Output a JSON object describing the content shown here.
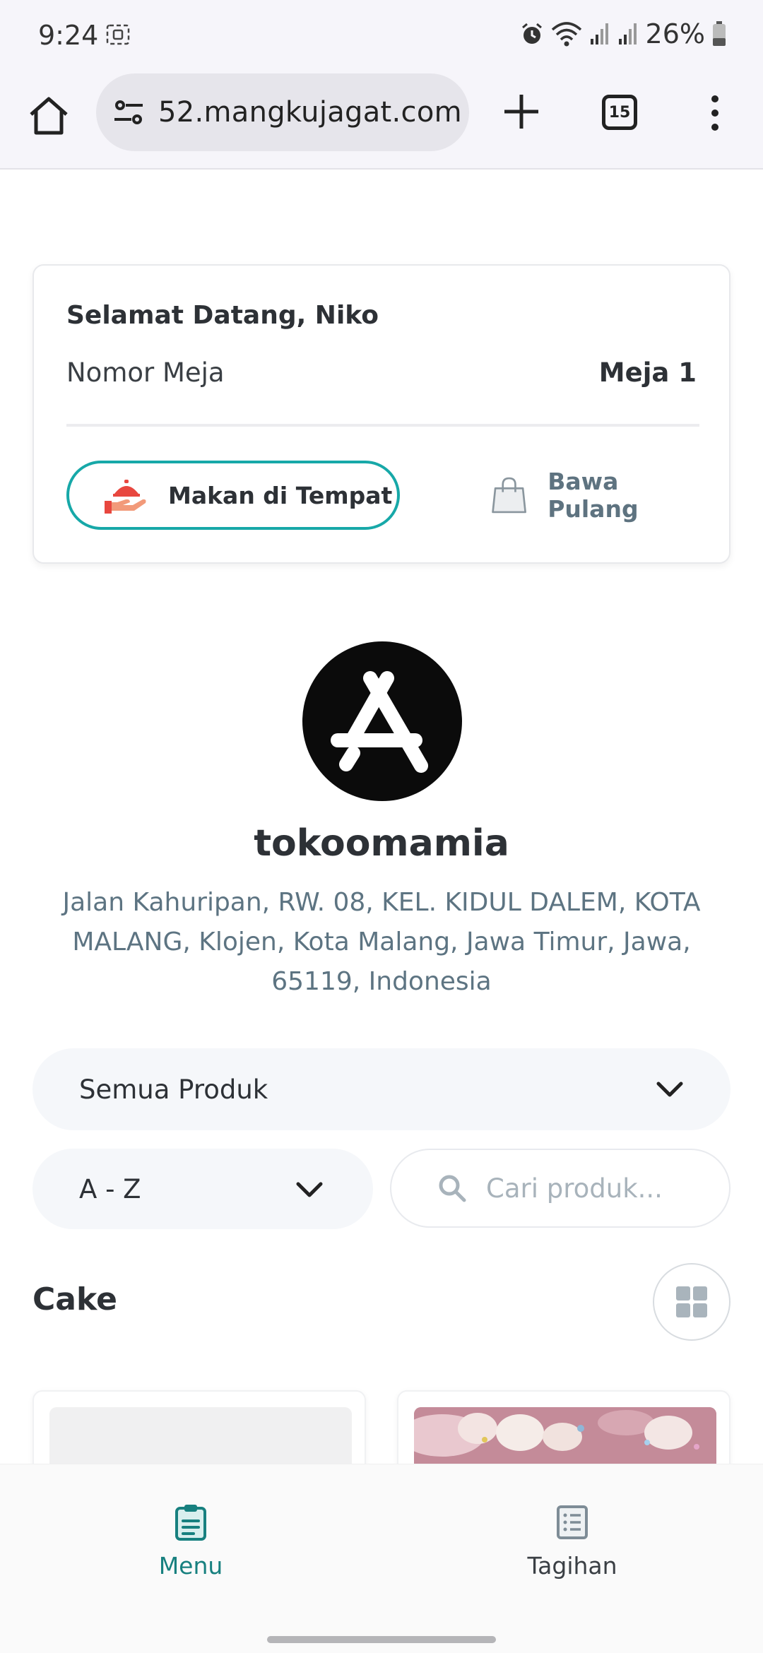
{
  "status_bar": {
    "time": "9:24",
    "battery_percent": "26%",
    "icons": [
      "screen-record-icon",
      "alarm-icon",
      "wifi-icon",
      "signal-icon",
      "signal-icon",
      "battery-icon"
    ]
  },
  "browser": {
    "url": "52.mangkujagat.com",
    "tab_count": "15",
    "icons": [
      "home-icon",
      "site-settings-icon",
      "new-tab-icon",
      "tabs-icon",
      "more-icon"
    ]
  },
  "welcome": {
    "title": "Selamat Datang, Niko",
    "table_label": "Nomor Meja",
    "table_value": "Meja 1",
    "order_types": [
      {
        "label": "Makan di Tempat",
        "icon": "dine-in-icon",
        "selected": true
      },
      {
        "label": "Bawa Pulang",
        "icon": "shopping-bag-icon",
        "selected": false
      }
    ]
  },
  "store": {
    "logo_icon": "app-store-logo-icon",
    "name": "tokoomamia",
    "address": "Jalan Kahuripan, RW. 08, KEL. KIDUL DALEM, KOTA MALANG, Klojen, Kota Malang, Jawa Timur, Jawa, 65119, Indonesia"
  },
  "filters": {
    "category_selected": "Semua Produk",
    "sort_selected": "A - Z",
    "search_placeholder": "Cari produk..."
  },
  "section": {
    "title": "Cake",
    "view_toggle_icon": "grid-view-icon"
  },
  "products": [
    {
      "image": "placeholder"
    },
    {
      "image": "pink-bear-cake"
    }
  ],
  "bottom_nav": {
    "items": [
      {
        "label": "Menu",
        "icon": "clipboard-icon",
        "active": true
      },
      {
        "label": "Tagihan",
        "icon": "bill-list-icon",
        "active": false
      }
    ]
  },
  "colors": {
    "accent": "#17a8a8",
    "nav_active": "#17807f",
    "address_text": "#5d7482",
    "dine_in_icon": "#e8473f"
  }
}
